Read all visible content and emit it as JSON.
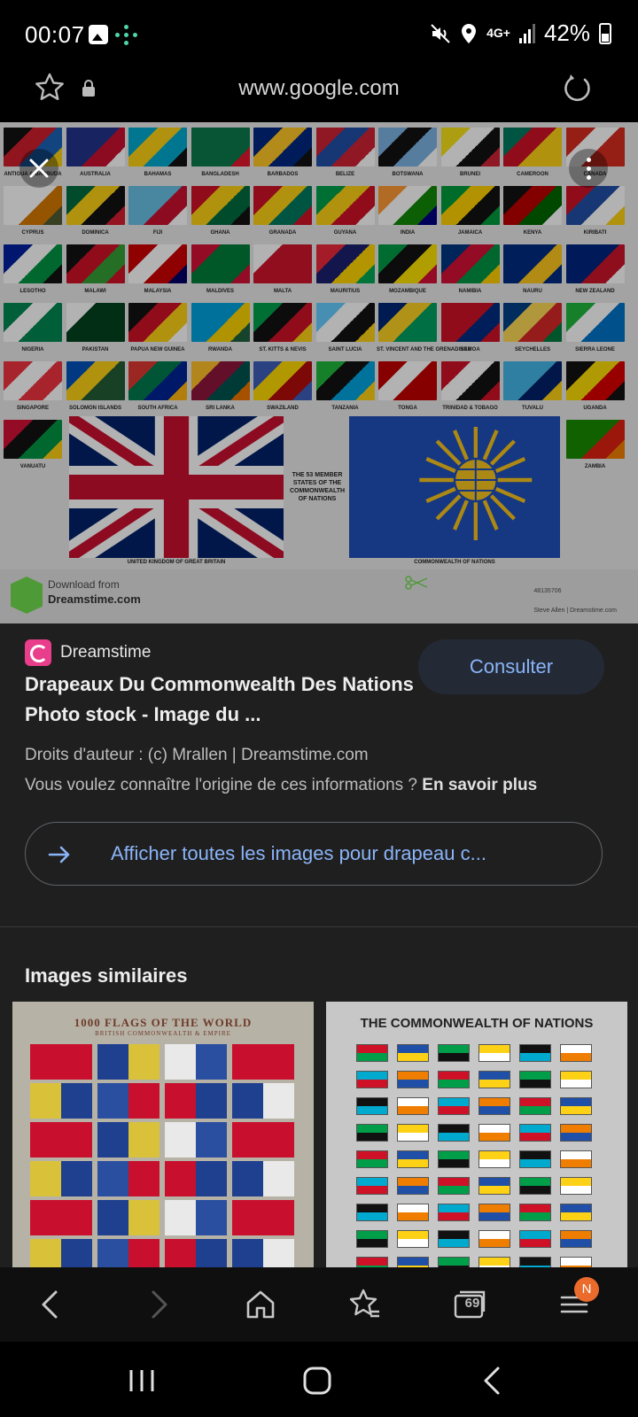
{
  "status_bar": {
    "time": "00:07",
    "network": "4G+",
    "battery_percent": "42%"
  },
  "url_bar": {
    "url": "www.google.com"
  },
  "image": {
    "flags": [
      {
        "name": "ANTIGUA & BARBUDA",
        "colors": [
          "#111111",
          "#cf1e2c",
          "#1961b5",
          "#f7d117"
        ]
      },
      {
        "name": "AUSTRALIA",
        "colors": [
          "#23348a",
          "#23348a",
          "#c8102e",
          "#ffffff"
        ]
      },
      {
        "name": "BAHAMAS",
        "colors": [
          "#00a9ce",
          "#fcd116",
          "#00a9ce",
          "#111111"
        ]
      },
      {
        "name": "BANGLADESH",
        "colors": [
          "#0a7a4a",
          "#0a7a4a",
          "#0a7a4a",
          "#e1162c"
        ]
      },
      {
        "name": "BARBADOS",
        "colors": [
          "#00267f",
          "#ffc726",
          "#00267f",
          "#111111"
        ]
      },
      {
        "name": "BELIZE",
        "colors": [
          "#cc2233",
          "#1f4fa6",
          "#cc2233",
          "#ffffff"
        ]
      },
      {
        "name": "BOTSWANA",
        "colors": [
          "#7bb2e1",
          "#111111",
          "#7bb2e1",
          "#ffffff"
        ]
      },
      {
        "name": "BRUNEI",
        "colors": [
          "#f7e017",
          "#ffffff",
          "#111111",
          "#cc2233"
        ]
      },
      {
        "name": "CAMEROON",
        "colors": [
          "#007a5e",
          "#ce1126",
          "#fcd116",
          "#fcd116"
        ]
      },
      {
        "name": "CANADA",
        "colors": [
          "#d52b1e",
          "#ffffff",
          "#d52b1e",
          "#d52b1e"
        ]
      },
      {
        "name": "CYPRUS",
        "colors": [
          "#ffffff",
          "#ffffff",
          "#d57800",
          "#4e5b31"
        ]
      },
      {
        "name": "DOMINICA",
        "colors": [
          "#006b3f",
          "#fcd116",
          "#111111",
          "#d41c30"
        ]
      },
      {
        "name": "FIJI",
        "colors": [
          "#68bfe5",
          "#68bfe5",
          "#c8102e",
          "#ffffff"
        ]
      },
      {
        "name": "GHANA",
        "colors": [
          "#ce1126",
          "#fcd116",
          "#006b3f",
          "#111111"
        ]
      },
      {
        "name": "GRANADA",
        "colors": [
          "#ce1126",
          "#fcd116",
          "#007a5e",
          "#ce1126"
        ]
      },
      {
        "name": "GUYANA",
        "colors": [
          "#009e49",
          "#fcd116",
          "#ce1126",
          "#ffffff"
        ]
      },
      {
        "name": "INDIA",
        "colors": [
          "#ff9933",
          "#ffffff",
          "#138808",
          "#000080"
        ]
      },
      {
        "name": "JAMAICA",
        "colors": [
          "#009b3a",
          "#fed100",
          "#111111",
          "#009b3a"
        ]
      },
      {
        "name": "KENYA",
        "colors": [
          "#111111",
          "#bb0000",
          "#006600",
          "#ffffff"
        ]
      },
      {
        "name": "KIRIBATI",
        "colors": [
          "#ce1126",
          "#1f4fa6",
          "#ffffff",
          "#fcd116"
        ]
      },
      {
        "name": "LESOTHO",
        "colors": [
          "#00209f",
          "#ffffff",
          "#009543",
          "#111111"
        ]
      },
      {
        "name": "MALAWI",
        "colors": [
          "#111111",
          "#ce1126",
          "#339e35",
          "#ce1126"
        ]
      },
      {
        "name": "MALAYSIA",
        "colors": [
          "#cc0001",
          "#ffffff",
          "#cc0001",
          "#010066"
        ]
      },
      {
        "name": "MALDIVES",
        "colors": [
          "#d21034",
          "#007e3a",
          "#007e3a",
          "#d21034"
        ]
      },
      {
        "name": "MALTA",
        "colors": [
          "#ffffff",
          "#cf142b",
          "#cf142b",
          "#cf142b"
        ]
      },
      {
        "name": "MAURITIUS",
        "colors": [
          "#ea2839",
          "#1a206d",
          "#ffd500",
          "#00a551"
        ]
      },
      {
        "name": "MOZAMBIQUE",
        "colors": [
          "#009a44",
          "#111111",
          "#fce100",
          "#d21034"
        ]
      },
      {
        "name": "NAMIBIA",
        "colors": [
          "#003580",
          "#d21034",
          "#009543",
          "#ffce00"
        ]
      },
      {
        "name": "NAURU",
        "colors": [
          "#002b7f",
          "#002b7f",
          "#ffc61e",
          "#002b7f"
        ]
      },
      {
        "name": "NEW ZEALAND",
        "colors": [
          "#00247d",
          "#00247d",
          "#cc142b",
          "#ffffff"
        ]
      },
      {
        "name": "NIGERIA",
        "colors": [
          "#008751",
          "#ffffff",
          "#008751",
          "#008751"
        ]
      },
      {
        "name": "PAKISTAN",
        "colors": [
          "#ffffff",
          "#01411c",
          "#01411c",
          "#01411c"
        ]
      },
      {
        "name": "PAPUA NEW GUINEA",
        "colors": [
          "#111111",
          "#ce1126",
          "#fcd116",
          "#ffffff"
        ]
      },
      {
        "name": "RWANDA",
        "colors": [
          "#00a1de",
          "#00a1de",
          "#fad201",
          "#20603d"
        ]
      },
      {
        "name": "ST. KITTS & NEVIS",
        "colors": [
          "#009e49",
          "#111111",
          "#ce1126",
          "#fcd116"
        ]
      },
      {
        "name": "SAINT LUCIA",
        "colors": [
          "#66ccff",
          "#ffffff",
          "#111111",
          "#fcd116"
        ]
      },
      {
        "name": "ST. VINCENT AND THE GRENADINES",
        "colors": [
          "#002674",
          "#fcd022",
          "#009e60",
          "#009e60"
        ]
      },
      {
        "name": "SAMOA",
        "colors": [
          "#ce1126",
          "#ce1126",
          "#002b7f",
          "#ce1126"
        ]
      },
      {
        "name": "SEYCHELLES",
        "colors": [
          "#003f87",
          "#fcd856",
          "#d62828",
          "#007a3d"
        ]
      },
      {
        "name": "SIERRA LEONE",
        "colors": [
          "#1eb53a",
          "#ffffff",
          "#0072c6",
          "#0072c6"
        ]
      },
      {
        "name": "SINGAPORE",
        "colors": [
          "#ef3340",
          "#ffffff",
          "#ef3340",
          "#ffffff"
        ]
      },
      {
        "name": "SOLOMON ISLANDS",
        "colors": [
          "#0051ba",
          "#fcd116",
          "#215b33",
          "#215b33"
        ]
      },
      {
        "name": "SOUTH AFRICA",
        "colors": [
          "#de3831",
          "#007a4d",
          "#002395",
          "#ffb612"
        ]
      },
      {
        "name": "SRI LANKA",
        "colors": [
          "#ffbe29",
          "#8d153a",
          "#00534e",
          "#eb7400"
        ]
      },
      {
        "name": "SWAZILAND",
        "colors": [
          "#3e5eb9",
          "#ffd900",
          "#b10c0c",
          "#3e5eb9"
        ]
      },
      {
        "name": "TANZANIA",
        "colors": [
          "#1eb53a",
          "#111111",
          "#00a3dd",
          "#fcd116"
        ]
      },
      {
        "name": "TONGA",
        "colors": [
          "#c10000",
          "#ffffff",
          "#c10000",
          "#c10000"
        ]
      },
      {
        "name": "TRINIDAD & TOBAGO",
        "colors": [
          "#ce1126",
          "#ffffff",
          "#111111",
          "#ce1126"
        ]
      },
      {
        "name": "TUVALU",
        "colors": [
          "#41b6e6",
          "#41b6e6",
          "#012169",
          "#fcd116"
        ]
      },
      {
        "name": "UGANDA",
        "colors": [
          "#111111",
          "#fcdc04",
          "#d90000",
          "#111111"
        ]
      },
      {
        "name": "VANUATU",
        "colors": [
          "#d21034",
          "#111111",
          "#009543",
          "#fdce12"
        ]
      },
      {
        "name": "ZAMBIA",
        "colors": [
          "#198a00",
          "#198a00",
          "#de2010",
          "#ef7d00"
        ]
      }
    ],
    "center_text": "THE 53 MEMBER STATES OF THE COMMONWEALTH OF NATIONS",
    "caption_left": "UNITED KINGDOM OF GREAT BRITAIN",
    "caption_right": "COMMONWEALTH OF NATIONS",
    "download_line1": "Download from",
    "download_line2": "Dreamstime.com",
    "image_id": "48135706",
    "author_credit": "Steve Allen | Dreamstime.com"
  },
  "info": {
    "source_name": "Dreamstime",
    "consult_label": "Consulter",
    "title": "Drapeaux Du Commonwealth Des Nations Photo stock - Image du ...",
    "copyright": "Droits d'auteur : (c) Mrallen | Dreamstime.com",
    "origin_question": "Vous voulez connaître l'origine de ces informations ?",
    "learn_more": "En savoir plus",
    "all_images_label": "Afficher toutes les images pour drapeau c..."
  },
  "similar": {
    "heading": "Images similaires",
    "left_title": "1000 FLAGS OF THE WORLD",
    "left_subtitle": "BRITISH COMMONWEALTH & EMPIRE",
    "right_title": "THE COMMONWEALTH OF NATIONS"
  },
  "browser_bar": {
    "tab_count": "69",
    "badge": "N"
  },
  "colors": {
    "accent": "#8ab4f8",
    "panel": "#1f1f1f",
    "badge": "#ea6b2c"
  }
}
